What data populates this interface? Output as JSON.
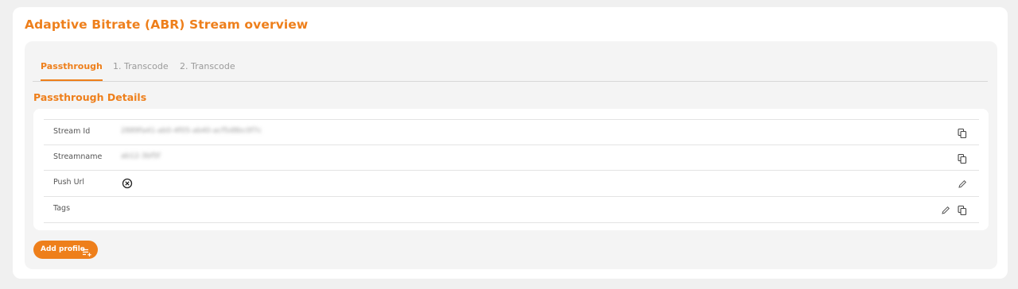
{
  "page": {
    "title": "Adaptive Bitrate (ABR) Stream overview"
  },
  "tabs": [
    {
      "label": "Passthrough",
      "active": true
    },
    {
      "label": "1. Transcode",
      "active": false
    },
    {
      "label": "2. Transcode",
      "active": false
    }
  ],
  "section": {
    "title": "Passthrough Details"
  },
  "details": {
    "rows": [
      {
        "label": "Stream Id",
        "value": "2889fa41-ab0-4f05-ab40-acf5d8bc0f7c",
        "actions": [
          "copy-icon"
        ]
      },
      {
        "label": "Streamname",
        "value": "ab12-3bf5f",
        "actions": [
          "copy-icon"
        ]
      },
      {
        "label": "Push Url",
        "value": "",
        "status_icon": "circle-x-icon",
        "actions": [
          "pencil-icon"
        ]
      },
      {
        "label": "Tags",
        "value": "",
        "actions": [
          "pencil-icon",
          "copy-icon"
        ]
      }
    ]
  },
  "add_profile": {
    "label": "Add profile",
    "icon": "playlist-add-icon"
  },
  "colors": {
    "accent": "#ee7f1b",
    "background": "#f0f0f0",
    "panel": "#f4f4f4"
  }
}
